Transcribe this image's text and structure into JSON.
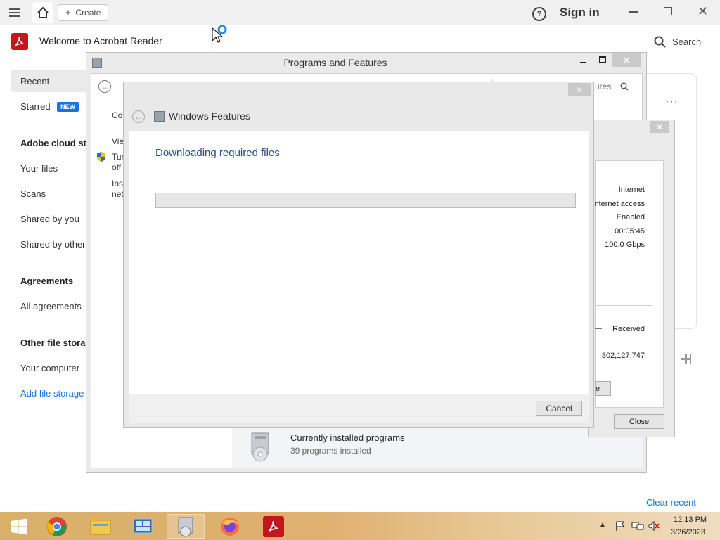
{
  "acrobat": {
    "create_label": "Create",
    "signin_label": "Sign in",
    "title": "Welcome to Acrobat Reader",
    "search_label": "Search",
    "new_badge": "NEW",
    "nav": {
      "recent": "Recent",
      "starred": "Starred",
      "cloud_header": "Adobe cloud sto",
      "your_files": "Your files",
      "scans": "Scans",
      "shared_by_you": "Shared by you",
      "shared_by_others": "Shared by others",
      "agreements_header": "Agreements",
      "all_agreements": "All agreements",
      "other_header": "Other file storag",
      "your_computer": "Your computer",
      "add_storage": "Add file storage"
    },
    "clear_recent": "Clear recent"
  },
  "programs": {
    "title": "Programs and Features",
    "search_fragment": "ures",
    "side_co": "Co",
    "side_view": "Vie",
    "side_turn": "Tur",
    "side_off": "off",
    "side_ins": "Ins",
    "side_net": "net",
    "bottom_title": "Currently installed programs",
    "bottom_sub": "39 programs installed"
  },
  "network": {
    "val1": "Internet",
    "val2": "nternet access",
    "val3": "Enabled",
    "val4": "00:05:45",
    "val5": "100.0 Gbps",
    "received_label": "Received",
    "received_value": "302,127,747",
    "close_label": "Close"
  },
  "features_dialog": {
    "title": "Windows Features",
    "heading": "Downloading required files",
    "progress": 0,
    "cancel_label": "Cancel",
    "colors": {
      "heading": "#1e4e8c"
    }
  },
  "taskbar": {
    "time": "12:13 PM",
    "date": "3/26/2023",
    "apps": [
      "windows-start",
      "chrome",
      "file-explorer",
      "network-connections",
      "programs-and-features",
      "firefox",
      "acrobat-reader"
    ]
  },
  "colors": {
    "accent": "#1473e6",
    "acrobat_red": "#c4161c"
  }
}
